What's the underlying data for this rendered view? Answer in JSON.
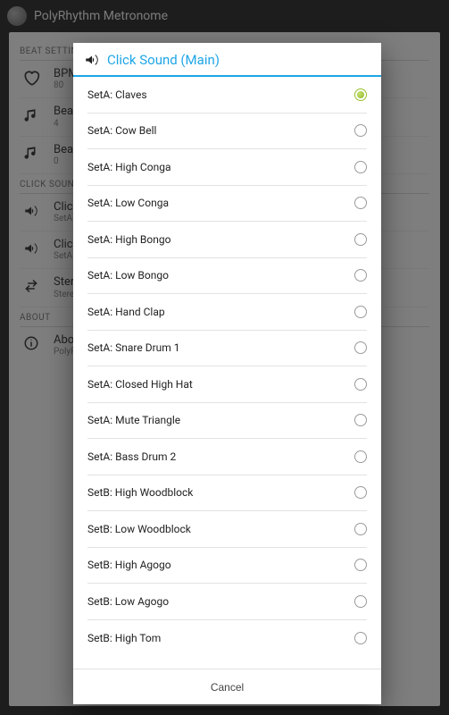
{
  "app": {
    "title": "PolyRhythm Metronome"
  },
  "bg": {
    "sections": {
      "beat": "BEAT SETTING",
      "click": "CLICK SOUND",
      "about": "ABOUT"
    },
    "rows": {
      "bpm": {
        "label": "BPM",
        "sub": "80"
      },
      "beat1": {
        "label": "Beat",
        "sub": "4"
      },
      "beat2": {
        "label": "Beat",
        "sub": "0"
      },
      "click1": {
        "label": "Click",
        "sub": "SetA"
      },
      "click2": {
        "label": "Click",
        "sub": "SetA"
      },
      "stereo": {
        "label": "Stereo",
        "sub": "Stereo"
      },
      "about": {
        "label": "About",
        "sub": "PolyRhythm"
      }
    }
  },
  "dialog": {
    "title": "Click Sound (Main)",
    "cancel": "Cancel",
    "selected_index": 0,
    "options": [
      "SetA: Claves",
      "SetA: Cow Bell",
      "SetA: High Conga",
      "SetA: Low Conga",
      "SetA: High Bongo",
      "SetA: Low Bongo",
      "SetA: Hand Clap",
      "SetA: Snare Drum 1",
      "SetA: Closed High Hat",
      "SetA: Mute Triangle",
      "SetA: Bass Drum 2",
      "SetB: High Woodblock",
      "SetB: Low Woodblock",
      "SetB: High Agogo",
      "SetB: Low Agogo",
      "SetB: High Tom"
    ]
  }
}
